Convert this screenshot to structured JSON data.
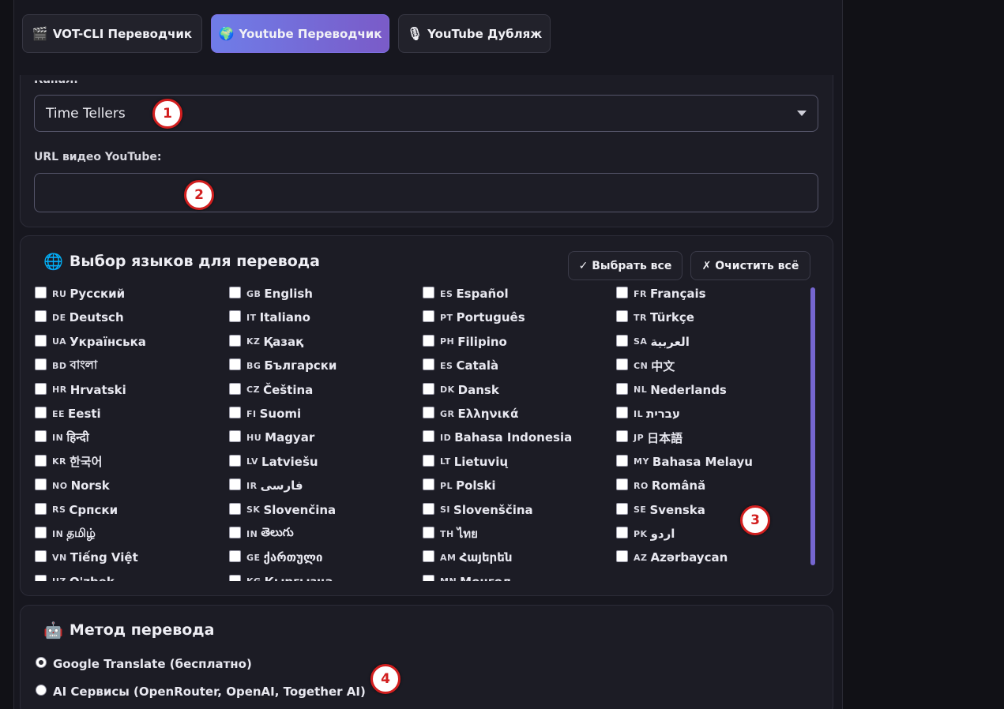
{
  "tabs": [
    {
      "icon": "🎬",
      "label": "VOT-CLI Переводчик"
    },
    {
      "icon": "🌍",
      "label": "Youtube Переводчик"
    },
    {
      "icon": "🎙",
      "label": "YouTube Дубляж"
    }
  ],
  "channel": {
    "label": "Канал:",
    "value": "Time Tellers"
  },
  "url": {
    "label": "URL видео YouTube:",
    "value": ""
  },
  "languages": {
    "icon": "🌐",
    "title": "Выбор языков для перевода",
    "select_all": "✓ Выбрать все",
    "clear_all": "✗ Очистить всё",
    "columns": [
      [
        {
          "code": "RU",
          "name": "Русский"
        },
        {
          "code": "DE",
          "name": "Deutsch"
        },
        {
          "code": "UA",
          "name": "Українська"
        },
        {
          "code": "BD",
          "name": "বাংলা"
        },
        {
          "code": "HR",
          "name": "Hrvatski"
        },
        {
          "code": "EE",
          "name": "Eesti"
        },
        {
          "code": "IN",
          "name": "हिन्दी"
        },
        {
          "code": "KR",
          "name": "한국어"
        },
        {
          "code": "NO",
          "name": "Norsk"
        },
        {
          "code": "RS",
          "name": "Српски"
        },
        {
          "code": "IN",
          "name": "தமிழ்"
        },
        {
          "code": "VN",
          "name": "Tiếng Việt"
        },
        {
          "code": "UZ",
          "name": "O'zbek"
        }
      ],
      [
        {
          "code": "GB",
          "name": "English"
        },
        {
          "code": "IT",
          "name": "Italiano"
        },
        {
          "code": "KZ",
          "name": "Қазақ"
        },
        {
          "code": "BG",
          "name": "Български"
        },
        {
          "code": "CZ",
          "name": "Čeština"
        },
        {
          "code": "FI",
          "name": "Suomi"
        },
        {
          "code": "HU",
          "name": "Magyar"
        },
        {
          "code": "LV",
          "name": "Latviešu"
        },
        {
          "code": "IR",
          "name": "فارسی"
        },
        {
          "code": "SK",
          "name": "Slovenčina"
        },
        {
          "code": "IN",
          "name": "తెలుగు"
        },
        {
          "code": "GE",
          "name": "ქართული"
        },
        {
          "code": "KG",
          "name": "Кыргызча"
        }
      ],
      [
        {
          "code": "ES",
          "name": "Español"
        },
        {
          "code": "PT",
          "name": "Português"
        },
        {
          "code": "PH",
          "name": "Filipino"
        },
        {
          "code": "ES",
          "name": "Català"
        },
        {
          "code": "DK",
          "name": "Dansk"
        },
        {
          "code": "GR",
          "name": "Ελληνικά"
        },
        {
          "code": "ID",
          "name": "Bahasa Indonesia"
        },
        {
          "code": "LT",
          "name": "Lietuvių"
        },
        {
          "code": "PL",
          "name": "Polski"
        },
        {
          "code": "SI",
          "name": "Slovenščina"
        },
        {
          "code": "TH",
          "name": "ไทย"
        },
        {
          "code": "AM",
          "name": "Հայերեն"
        },
        {
          "code": "MN",
          "name": "Монгол"
        }
      ],
      [
        {
          "code": "FR",
          "name": "Français"
        },
        {
          "code": "TR",
          "name": "Türkçe"
        },
        {
          "code": "SA",
          "name": "العربية"
        },
        {
          "code": "CN",
          "name": "中文"
        },
        {
          "code": "NL",
          "name": "Nederlands"
        },
        {
          "code": "IL",
          "name": "עברית"
        },
        {
          "code": "JP",
          "name": "日本語"
        },
        {
          "code": "MY",
          "name": "Bahasa Melayu"
        },
        {
          "code": "RO",
          "name": "Română"
        },
        {
          "code": "SE",
          "name": "Svenska"
        },
        {
          "code": "PK",
          "name": "اردو"
        },
        {
          "code": "AZ",
          "name": "Azərbaycan"
        }
      ]
    ]
  },
  "method": {
    "icon": "🤖",
    "title": "Метод перевода",
    "options": [
      {
        "label": "Google Translate (бесплатно)",
        "checked": true
      },
      {
        "label": "AI Сервисы (OpenRouter, OpenAI, Together AI)",
        "checked": false
      }
    ]
  },
  "markers": [
    "1",
    "2",
    "3",
    "4"
  ],
  "colors": {
    "accent_start": "#6f7de8",
    "accent_end": "#7a5bc8",
    "marker": "#d21f1f",
    "scrollbar": "#7566d0"
  }
}
